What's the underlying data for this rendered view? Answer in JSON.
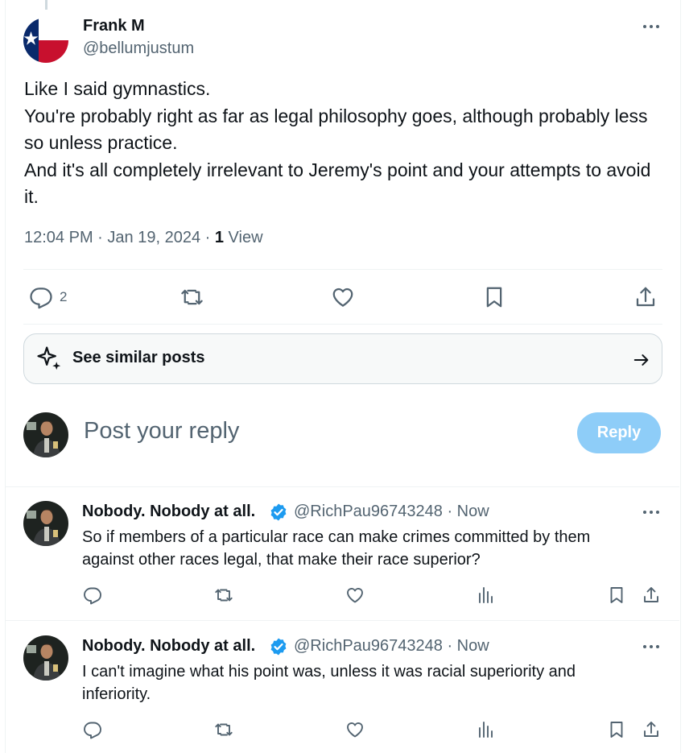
{
  "main_tweet": {
    "author_name": "Frank M",
    "author_handle": "@bellumjustum",
    "avatar_icon": "texas-flag-icon",
    "text_lines": [
      "Like I said gymnastics.",
      "You're probably right as far as legal philosophy goes, although probably less so unless practice.",
      "And it's all completely irrelevant to Jeremy's point and your attempts to avoid it."
    ],
    "time": "12:04 PM",
    "date": "Jan 19, 2024",
    "views_count": "1",
    "views_label": "View",
    "separator": "·",
    "reply_count": "2"
  },
  "similar_posts": {
    "label": "See similar posts",
    "icon": "sparkle-icon",
    "arrow_icon": "arrow-right-icon"
  },
  "composer": {
    "placeholder": "Post your reply",
    "button_label": "Reply",
    "button_color": "#8ecdf8"
  },
  "replies": [
    {
      "author_name": "Nobody. Nobody at all.",
      "author_handle": "@RichPau96743248",
      "time": "· Now",
      "verified_icon": "verified-badge-icon",
      "text": "So if members of a particular race can make crimes committed by them against other races legal, that make their race superior?"
    },
    {
      "author_name": "Nobody. Nobody at all.",
      "author_handle": "@RichPau96743248",
      "time": "· Now",
      "verified_icon": "verified-badge-icon",
      "text": "I can't imagine what his point was, unless it was racial superiority and inferiority."
    }
  ],
  "colors": {
    "text": "#0f1419",
    "muted": "#536471",
    "verified": "#1d9bf0",
    "border": "#eff3f4"
  }
}
